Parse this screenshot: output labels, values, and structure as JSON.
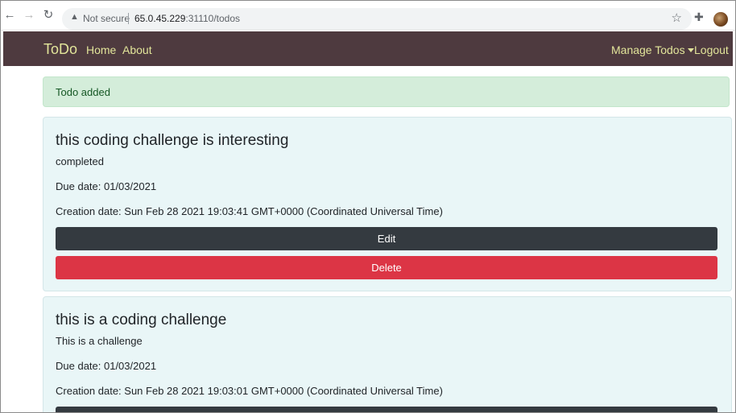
{
  "browser": {
    "back_icon": "←",
    "forward_icon": "→",
    "reload_icon": "↻",
    "security_icon": "▲",
    "security_text": "Not secure",
    "url_host": "65.0.45.229",
    "url_rest": ":31110/todos",
    "star_icon": "☆",
    "extensions_icon": "✚"
  },
  "navbar": {
    "brand": "ToDo",
    "links": [
      "Home",
      "About"
    ],
    "manage": "Manage Todos",
    "logout": "Logout",
    "bg_color": "#4e3a3f",
    "link_color": "#e2e59a"
  },
  "alert": {
    "text": "Todo added"
  },
  "todos": [
    {
      "title": "this coding challenge is interesting",
      "description": "completed",
      "due": "Due date: 01/03/2021",
      "created": "Creation date: Sun Feb 28 2021 19:03:41 GMT+0000 (Coordinated Universal Time)",
      "edit_label": "Edit",
      "delete_label": "Delete"
    },
    {
      "title": "this is a coding challenge",
      "description": "This is a challenge",
      "due": "Due date: 01/03/2021",
      "created": "Creation date: Sun Feb 28 2021 19:03:01 GMT+0000 (Coordinated Universal Time)"
    }
  ]
}
